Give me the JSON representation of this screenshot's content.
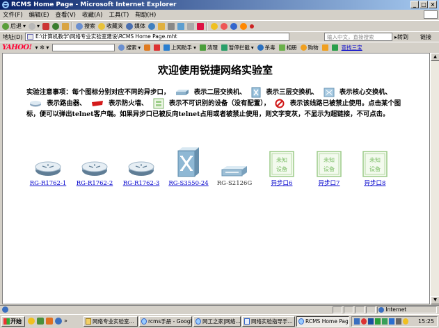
{
  "window": {
    "title": "RCMS Home Page - Microsoft Internet Explorer"
  },
  "menu": [
    "文件(F)",
    "编辑(E)",
    "查看(V)",
    "收藏(A)",
    "工具(T)",
    "帮助(H)"
  ],
  "toolbar": {
    "back": "后退",
    "search": "搜索",
    "favorites": "收藏夹",
    "media": "媒体"
  },
  "address": {
    "label": "地址(D)",
    "url": "E:\\计算机教学\\网络专业实验室建设\\RCMS Home Page.mht",
    "search_hint": "输入中文，直接搜索",
    "go": "转到",
    "links": "链接"
  },
  "yahoo": {
    "logo": "YAHOO!",
    "search": "搜索",
    "assistant": "上网助手",
    "clean": "清理",
    "popup": "暂停拦截",
    "kill": "杀毒",
    "album": "相册",
    "shop": "购物",
    "link": "查找三宝"
  },
  "page": {
    "title": "欢迎使用锐捷网络实验室",
    "notes": {
      "t1": "实验注意事项：每个图标分别对应不同的异步口，",
      "t2": "表示二层交换机、",
      "t3": "表示三层交换机、",
      "t4": "表示核心交换机、",
      "t5": "表示路由器、",
      "t6": "表示防火墙、",
      "t7": "表示不可识别的设备（没有配置），",
      "t8": "表示该线路已被禁止使用。点击某个图标，便可以弹出telnet客户端。如果异步口已被反向telnet占用或者被禁止使用，则文字变灰，不显示为超链接，不可点击。"
    },
    "devices": [
      {
        "label": "RG-R1762-1",
        "type": "router",
        "link": true
      },
      {
        "label": "RG-R1762-2",
        "type": "router",
        "link": true
      },
      {
        "label": "RG-R1762-3",
        "type": "router",
        "link": true
      },
      {
        "label": "RG-S3550-24",
        "type": "l3switch",
        "link": true
      },
      {
        "label": "RG-S2126G",
        "type": "l2switch",
        "link": false
      },
      {
        "label": "异步口6",
        "type": "unknown",
        "link": true
      },
      {
        "label": "异步口7",
        "type": "unknown",
        "link": true
      },
      {
        "label": "异步口8",
        "type": "unknown",
        "link": true
      }
    ],
    "unknown_icon_text": [
      "未知",
      "设备"
    ]
  },
  "status": {
    "zone": "Internet"
  },
  "taskbar": {
    "start": "开始",
    "tasks": [
      "网络专业实验室...",
      "rcms手册 - Googl...",
      "网工之家|网络...",
      "网络实验指导手...",
      "RCMS Home Page..."
    ],
    "clock": "15:25"
  },
  "colors": {
    "link": "#0000cc",
    "title_bar_start": "#0a246a",
    "title_bar_end": "#a6caf0"
  }
}
